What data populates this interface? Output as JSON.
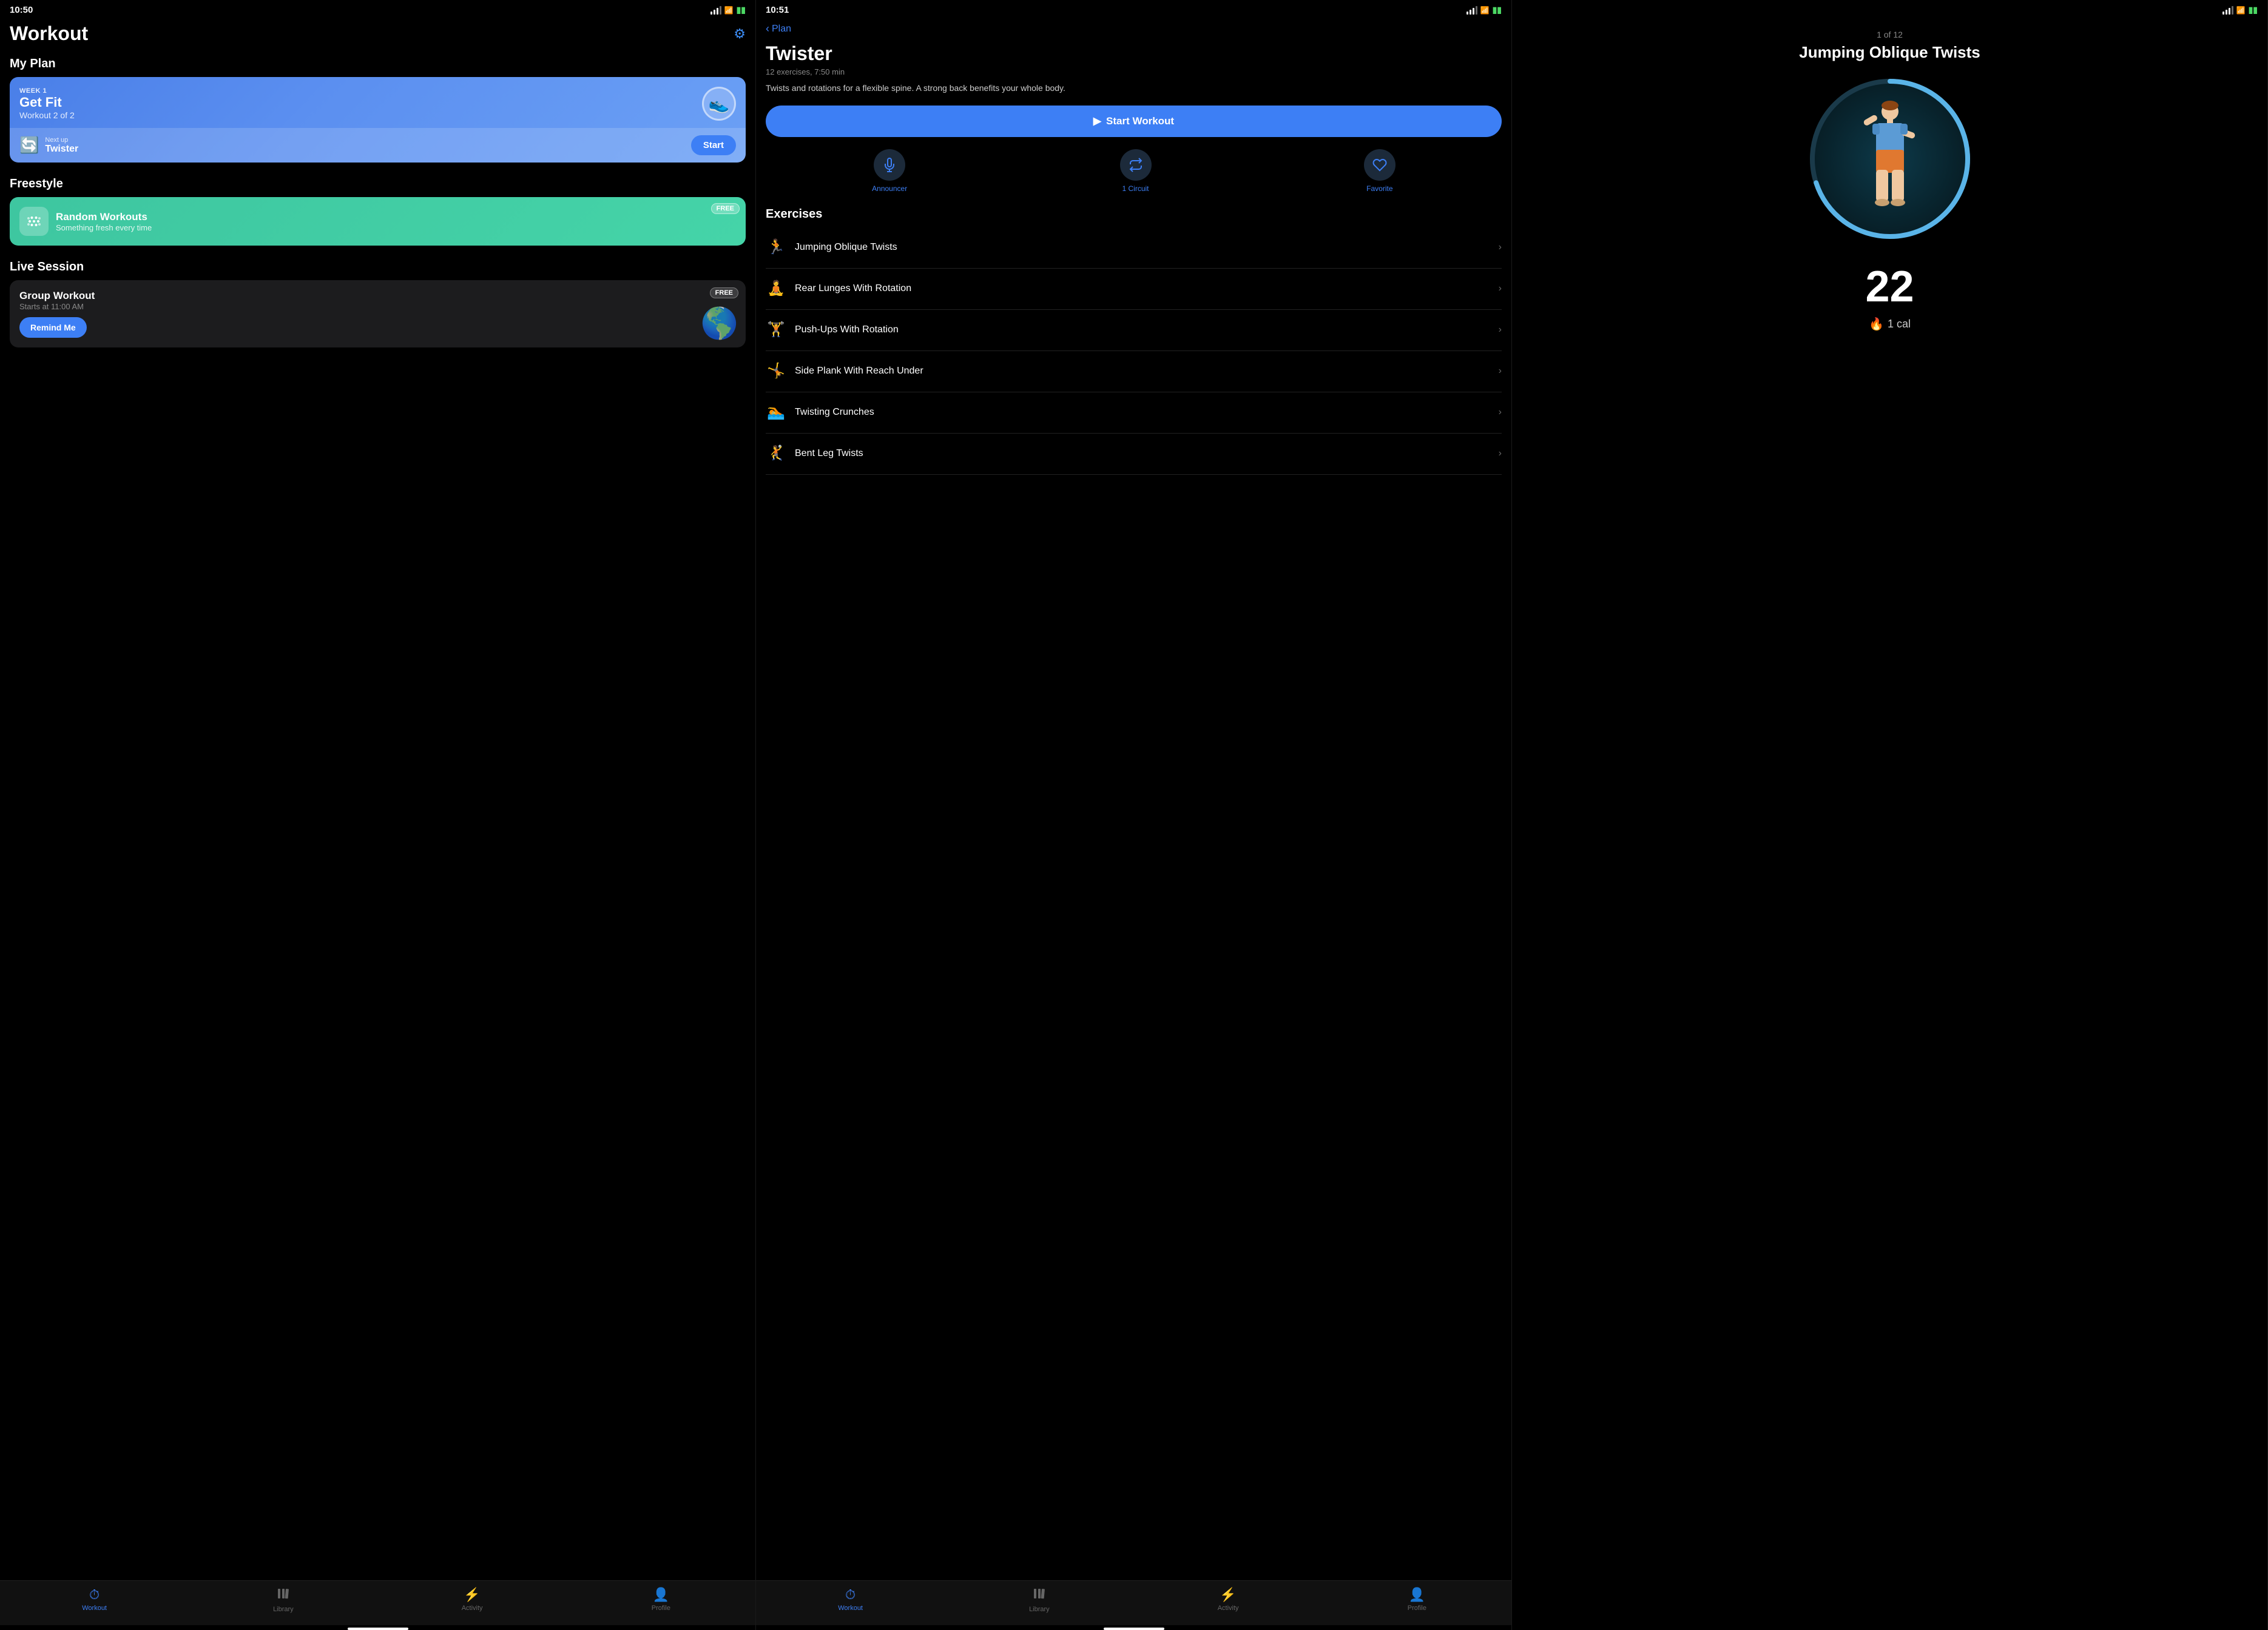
{
  "panel1": {
    "status": {
      "time": "10:50",
      "location_arrow": "▶",
      "battery": "🔋"
    },
    "page_title": "Workout",
    "settings_icon": "⚙",
    "my_plan_label": "My Plan",
    "plan_card": {
      "week_label": "WEEK 1",
      "title": "Get Fit",
      "subtitle": "Workout 2 of 2",
      "shoe_emoji": "👟",
      "next_up_label": "Next up",
      "next_up_name": "Twister",
      "start_btn": "Start"
    },
    "freestyle_label": "Freestyle",
    "freestyle_card": {
      "title": "Random Workouts",
      "subtitle": "Something fresh every time",
      "badge": "FREE"
    },
    "live_session_label": "Live Session",
    "live_card": {
      "title": "Group Workout",
      "subtitle": "Starts at 11:00 AM",
      "remind_btn": "Remind Me",
      "badge": "FREE"
    },
    "nav": {
      "items": [
        {
          "icon": "⏱",
          "label": "Workout",
          "active": true
        },
        {
          "icon": "📚",
          "label": "Library",
          "active": false
        },
        {
          "icon": "⚡",
          "label": "Activity",
          "active": false
        },
        {
          "icon": "👤",
          "label": "Profile",
          "active": false
        }
      ]
    }
  },
  "panel2": {
    "status": {
      "time": "10:51",
      "location_arrow": "▶",
      "battery": "🔋"
    },
    "back_label": "Plan",
    "workout_title": "Twister",
    "workout_meta": "12 exercises, 7:50 min",
    "workout_desc": "Twists and rotations for a flexible spine. A strong back benefits your whole body.",
    "start_btn": "Start Workout",
    "actions": [
      {
        "icon": "🎙",
        "label": "Announcer"
      },
      {
        "icon": "🔄",
        "label": "1 Circuit"
      },
      {
        "icon": "♡",
        "label": "Favorite"
      }
    ],
    "exercises_label": "Exercises",
    "exercises": [
      {
        "name": "Jumping Oblique Twists",
        "figure": "🏃"
      },
      {
        "name": "Rear Lunges With Rotation",
        "figure": "🧘"
      },
      {
        "name": "Push-Ups With Rotation",
        "figure": "🏋"
      },
      {
        "name": "Side Plank With Reach Under",
        "figure": "🤸"
      },
      {
        "name": "Twisting Crunches",
        "figure": "🏊"
      },
      {
        "name": "Bent Leg Twists",
        "figure": "🤾"
      }
    ],
    "nav": {
      "items": [
        {
          "icon": "⏱",
          "label": "Workout",
          "active": true
        },
        {
          "icon": "📚",
          "label": "Library",
          "active": false
        },
        {
          "icon": "⚡",
          "label": "Activity",
          "active": false
        },
        {
          "icon": "👤",
          "label": "Profile",
          "active": false
        }
      ]
    }
  },
  "panel3": {
    "progress_label": "1 of 12",
    "exercise_title": "Jumping Oblique Twists",
    "rep_count": "22",
    "cal_label": "1 cal",
    "flame": "🔥"
  }
}
